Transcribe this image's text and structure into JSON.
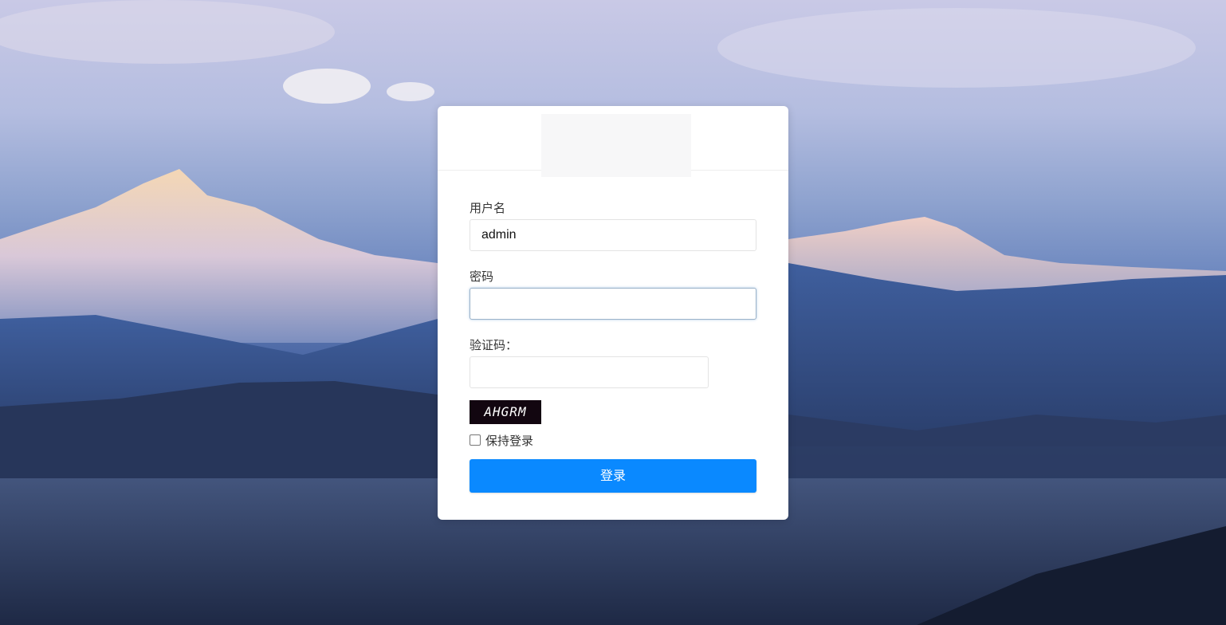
{
  "login": {
    "username_label": "用户名",
    "username_value": "admin",
    "password_label": "密码",
    "password_value": "",
    "captcha_label": "验证码：",
    "captcha_value": "",
    "captcha_image_text": "AHGRM",
    "remember_label": "保持登录",
    "remember_checked": false,
    "submit_label": "登录"
  },
  "colors": {
    "primary_button": "#0a89ff",
    "card_background": "#ffffff"
  }
}
